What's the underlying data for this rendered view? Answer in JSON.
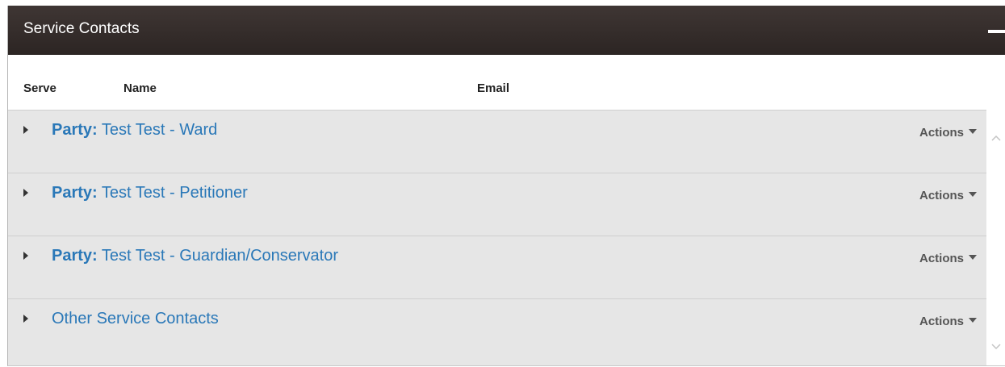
{
  "panel": {
    "title": "Service Contacts"
  },
  "columns": {
    "serve": "Serve",
    "name": "Name",
    "email": "Email"
  },
  "rows": [
    {
      "prefix": "Party:",
      "label": "Test Test - Ward",
      "actions": "Actions"
    },
    {
      "prefix": "Party:",
      "label": "Test Test - Petitioner",
      "actions": "Actions"
    },
    {
      "prefix": "Party:",
      "label": "Test Test - Guardian/Conservator",
      "actions": "Actions"
    },
    {
      "prefix": "",
      "label": "Other Service Contacts",
      "actions": "Actions"
    }
  ],
  "icons": {
    "collapse": "minus-icon",
    "expand": "caret-right-icon",
    "dropdown": "caret-down-icon",
    "scroll_up": "chevron-up-icon",
    "scroll_down": "chevron-down-icon"
  },
  "colors": {
    "header_bg": "#2c2523",
    "link": "#2a78b8",
    "row_bg": "#e6e6e6"
  }
}
